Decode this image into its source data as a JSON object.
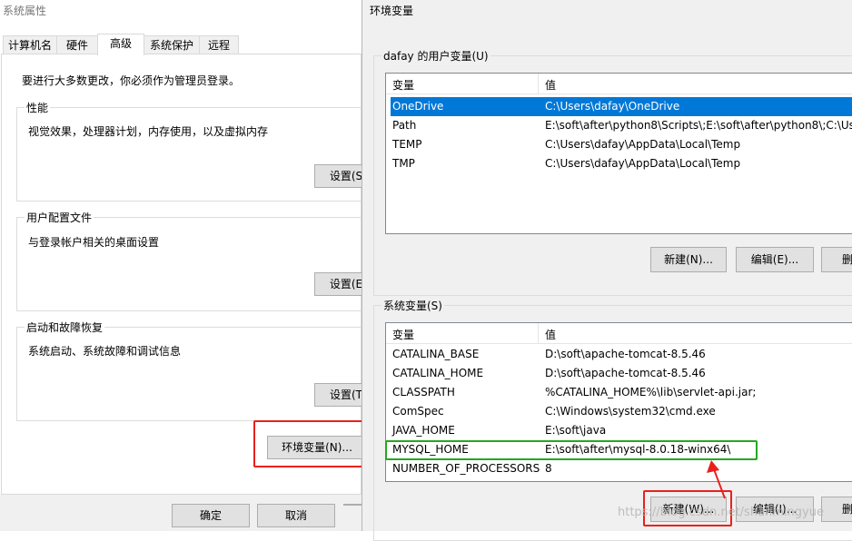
{
  "system_properties": {
    "title": "系统属性",
    "tabs": [
      {
        "label": "计算机名"
      },
      {
        "label": "硬件"
      },
      {
        "label": "高级"
      },
      {
        "label": "系统保护"
      },
      {
        "label": "远程"
      }
    ],
    "admin_note": "要进行大多数更改，你必须作为管理员登录。",
    "performance": {
      "label": "性能",
      "desc": "视觉效果，处理器计划，内存使用，以及虚拟内存",
      "button": "设置(S"
    },
    "user_profiles": {
      "label": "用户配置文件",
      "desc": "与登录帐户相关的桌面设置",
      "button": "设置(E"
    },
    "startup": {
      "label": "启动和故障恢复",
      "desc": "系统启动、系统故障和调试信息",
      "button": "设置(T"
    },
    "env_button": "环境变量(N)...",
    "footer": {
      "ok": "确定",
      "cancel": "取消"
    }
  },
  "env_vars": {
    "title": "环境变量",
    "user_section": {
      "label": "dafay 的用户变量(U)",
      "col_var": "变量",
      "col_val": "值",
      "rows": [
        {
          "name": "OneDrive",
          "value": "C:\\Users\\dafay\\OneDrive"
        },
        {
          "name": "Path",
          "value": "E:\\soft\\after\\python8\\Scripts\\;E:\\soft\\after\\python8\\;C:\\Use"
        },
        {
          "name": "TEMP",
          "value": "C:\\Users\\dafay\\AppData\\Local\\Temp"
        },
        {
          "name": "TMP",
          "value": "C:\\Users\\dafay\\AppData\\Local\\Temp"
        }
      ],
      "buttons": {
        "new": "新建(N)...",
        "edit": "编辑(E)...",
        "delete": "删"
      }
    },
    "system_section": {
      "label": "系统变量(S)",
      "col_var": "变量",
      "col_val": "值",
      "rows": [
        {
          "name": "CATALINA_BASE",
          "value": "D:\\soft\\apache-tomcat-8.5.46"
        },
        {
          "name": "CATALINA_HOME",
          "value": "D:\\soft\\apache-tomcat-8.5.46"
        },
        {
          "name": "CLASSPATH",
          "value": "%CATALINA_HOME%\\lib\\servlet-api.jar;"
        },
        {
          "name": "ComSpec",
          "value": "C:\\Windows\\system32\\cmd.exe"
        },
        {
          "name": "JAVA_HOME",
          "value": "E:\\soft\\java"
        },
        {
          "name": "MYSQL_HOME",
          "value": "E:\\soft\\after\\mysql-8.0.18-winx64\\"
        },
        {
          "name": "NUMBER_OF_PROCESSORS",
          "value": "8"
        }
      ],
      "buttons": {
        "new": "新建(W)...",
        "edit": "编辑(I)...",
        "delete": "删"
      }
    }
  },
  "watermark": "https://blog.csdn.net/shanmingyue",
  "colors": {
    "selection": "#0078d7",
    "annotation_red": "#e8211c",
    "annotation_green": "#23a820"
  }
}
